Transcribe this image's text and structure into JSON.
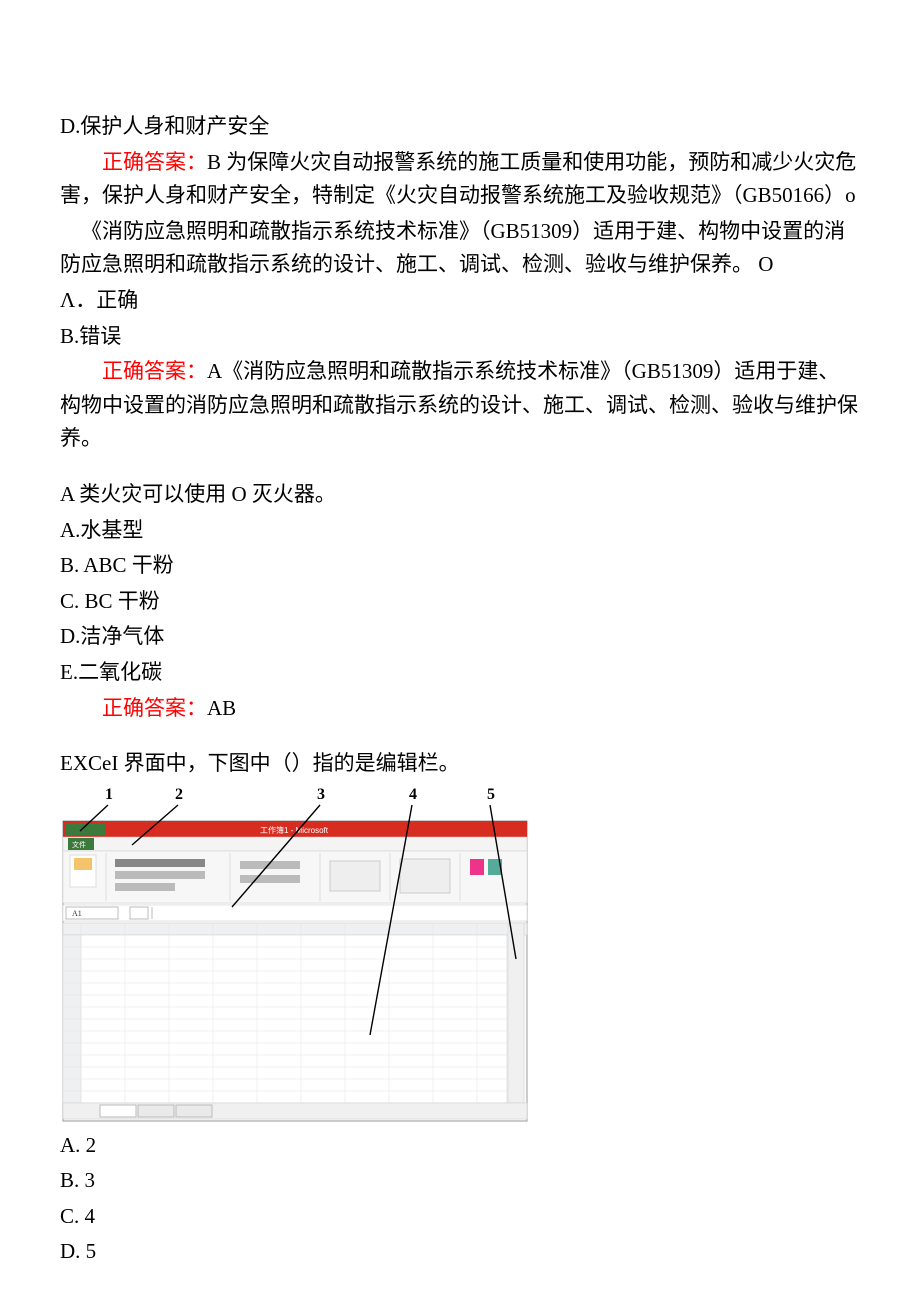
{
  "q1": {
    "opt_d": "D.保护人身和财产安全",
    "ans_label": "正确答案：",
    "ans_text1": "B 为保障火灾自动报警系统的施工质量和使用功能，预防和减少火灾危害，保护人身和财产安全，特制定《火灾自动报警系统施工及验收规范》（GB50166）o"
  },
  "q2": {
    "stem1": "《消防应急照明和疏散指示系统技术标准》（GB51309）适用于建、构物中设置的消防应急照明和疏散指示系统的设计、施工、调试、检测、验收与维护保养。 O",
    "opt_a": "Λ．正确",
    "opt_b": "B.错误",
    "ans_label": "正确答案：",
    "ans_text": "A《消防应急照明和疏散指示系统技术标准》（GB51309）适用于建、构物中设置的消防应急照明和疏散指示系统的设计、施工、调试、检测、验收与维护保养。"
  },
  "q3": {
    "stem": "A 类火灾可以使用 O 灭火器。",
    "opt_a": "A.水基型",
    "opt_b": "B. ABC 干粉",
    "opt_c": "C. BC 干粉",
    "opt_d": "D.洁净气体",
    "opt_e": "E.二氧化碳",
    "ans_label": "正确答案：",
    "ans_text": "AB"
  },
  "q4": {
    "stem": "EXCeI 界面中，下图中（）指的是编辑栏。",
    "labels": [
      "1",
      "2",
      "3",
      "4",
      "5"
    ],
    "opt_a": "A. 2",
    "opt_b": "B. 3",
    "opt_c": "C. 4",
    "opt_d": "D. 5"
  }
}
